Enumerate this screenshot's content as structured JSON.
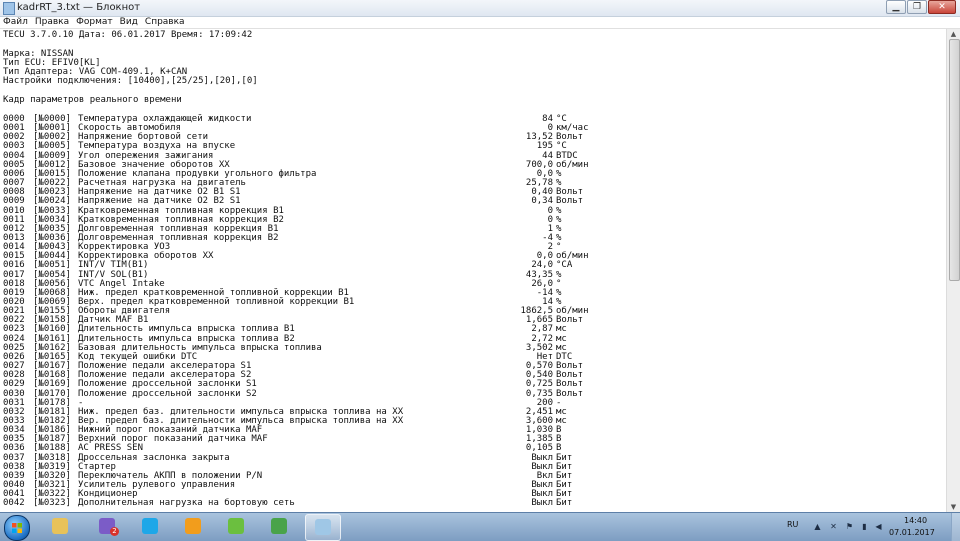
{
  "window": {
    "title": "kadrRT_3.txt — Блокнот"
  },
  "menu": [
    "Файл",
    "Правка",
    "Формат",
    "Вид",
    "Справка"
  ],
  "header": {
    "line1": "TECU 3.7.0.10 Дата: 06.01.2017 Время: 17:09:42",
    "make": "Марка: NISSAN",
    "ecu": "Тип ECU: EFIV0[KL]",
    "adapter": "Тип Адаптера: VAG COM-409.1, K+CAN",
    "settings": "Настройки подключения: [10400],[25/25],[20],[0]",
    "frame": "Кадр параметров реального времени"
  },
  "rows": [
    {
      "idx": "0000",
      "code": "[№0000]",
      "name": "Температура охлаждающей жидкости",
      "value": "84",
      "unit": "°C"
    },
    {
      "idx": "0001",
      "code": "[№0001]",
      "name": "Скорость автомобиля",
      "value": "0",
      "unit": "км/час"
    },
    {
      "idx": "0002",
      "code": "[№0002]",
      "name": "Напряжение бортовой сети",
      "value": "13,52",
      "unit": "Вольт"
    },
    {
      "idx": "0003",
      "code": "[№0005]",
      "name": "Температура воздуха на впуске",
      "value": "195",
      "unit": "°C"
    },
    {
      "idx": "0004",
      "code": "[№0009]",
      "name": "Угол опережения зажигания",
      "value": "44",
      "unit": "BTDC"
    },
    {
      "idx": "0005",
      "code": "[№0012]",
      "name": "Базовое значение оборотов XX",
      "value": "700,0",
      "unit": "об/мин"
    },
    {
      "idx": "0006",
      "code": "[№0015]",
      "name": "Положение клапана продувки угольного фильтра",
      "value": "0,0",
      "unit": "%"
    },
    {
      "idx": "0007",
      "code": "[№0022]",
      "name": "Расчетная нагрузка на двигатель",
      "value": "25,78",
      "unit": "%"
    },
    {
      "idx": "0008",
      "code": "[№0023]",
      "name": "Напряжение на датчике O2 B1 S1",
      "value": "0,40",
      "unit": "Вольт"
    },
    {
      "idx": "0009",
      "code": "[№0024]",
      "name": "Напряжение на датчике O2 B2 S1",
      "value": "0,34",
      "unit": "Вольт"
    },
    {
      "idx": "0010",
      "code": "[№0033]",
      "name": "Кратковременная топливная коррекция B1",
      "value": "0",
      "unit": "%"
    },
    {
      "idx": "0011",
      "code": "[№0034]",
      "name": "Кратковременная топливная коррекция B2",
      "value": "0",
      "unit": "%"
    },
    {
      "idx": "0012",
      "code": "[№0035]",
      "name": "Долговременная топливная коррекция B1",
      "value": "1",
      "unit": "%"
    },
    {
      "idx": "0013",
      "code": "[№0036]",
      "name": "Долговременная топливная коррекция B2",
      "value": "-4",
      "unit": "%"
    },
    {
      "idx": "0014",
      "code": "[№0043]",
      "name": "Корректировка УОЗ",
      "value": "2",
      "unit": "°"
    },
    {
      "idx": "0015",
      "code": "[№0044]",
      "name": "Корректировка оборотов XX",
      "value": "0,0",
      "unit": "об/мин"
    },
    {
      "idx": "0016",
      "code": "[№0051]",
      "name": "INT/V TIM(B1)",
      "value": "24,0",
      "unit": "°CA"
    },
    {
      "idx": "0017",
      "code": "[№0054]",
      "name": "INT/V SOL(B1)",
      "value": "43,35",
      "unit": "%"
    },
    {
      "idx": "0018",
      "code": "[№0056]",
      "name": "VTC Angel Intake",
      "value": "26,0",
      "unit": "°"
    },
    {
      "idx": "0019",
      "code": "[№0068]",
      "name": "Ниж. предел кратковременной топливной коррекции B1",
      "value": "-14",
      "unit": "%"
    },
    {
      "idx": "0020",
      "code": "[№0069]",
      "name": "Верх. предел кратковременной топливной коррекции B1",
      "value": "14",
      "unit": "%"
    },
    {
      "idx": "0021",
      "code": "[№0155]",
      "name": "Обороты двигателя",
      "value": "1862,5",
      "unit": "об/мин"
    },
    {
      "idx": "0022",
      "code": "[№0158]",
      "name": "Датчик MAF B1",
      "value": "1,665",
      "unit": "Вольт"
    },
    {
      "idx": "0023",
      "code": "[№0160]",
      "name": "Длительность импульса впрыска топлива B1",
      "value": "2,87",
      "unit": "мс"
    },
    {
      "idx": "0024",
      "code": "[№0161]",
      "name": "Длительность импульса впрыска топлива B2",
      "value": "2,72",
      "unit": "мс"
    },
    {
      "idx": "0025",
      "code": "[№0162]",
      "name": "Базовая длительность импульса впрыска топлива",
      "value": "3,502",
      "unit": "мс"
    },
    {
      "idx": "0026",
      "code": "[№0165]",
      "name": "Код текущей ошибки DTC",
      "value": "Нет",
      "unit": "DTC"
    },
    {
      "idx": "0027",
      "code": "[№0167]",
      "name": "Положение педали акселератора S1",
      "value": "0,570",
      "unit": "Вольт"
    },
    {
      "idx": "0028",
      "code": "[№0168]",
      "name": "Положение педали акселератора S2",
      "value": "0,540",
      "unit": "Вольт"
    },
    {
      "idx": "0029",
      "code": "[№0169]",
      "name": "Положение дроссельной заслонки S1",
      "value": "0,725",
      "unit": "Вольт"
    },
    {
      "idx": "0030",
      "code": "[№0170]",
      "name": "Положение дроссельной заслонки S2",
      "value": "0,735",
      "unit": "Вольт"
    },
    {
      "idx": "0031",
      "code": "[№0178]",
      "name": "-",
      "value": "200",
      "unit": "-"
    },
    {
      "idx": "0032",
      "code": "[№0181]",
      "name": "Ниж. предел баз. длительности импульса впрыска топлива на XX",
      "value": "2,451",
      "unit": "мс"
    },
    {
      "idx": "0033",
      "code": "[№0182]",
      "name": "Вер. предел баз. длительности импульса впрыска топлива на XX",
      "value": "3,600",
      "unit": "мс"
    },
    {
      "idx": "0034",
      "code": "[№0186]",
      "name": "Нижний порог показаний датчика MAF",
      "value": "1,030",
      "unit": "В"
    },
    {
      "idx": "0035",
      "code": "[№0187]",
      "name": "Верхний порог показаний датчика MAF",
      "value": "1,385",
      "unit": "В"
    },
    {
      "idx": "0036",
      "code": "[№0188]",
      "name": "AC PRESS SEN",
      "value": "0,105",
      "unit": "В"
    },
    {
      "idx": "0037",
      "code": "[№0318]",
      "name": "Дроссельная заслонка закрыта",
      "value": "Выкл",
      "unit": "Бит"
    },
    {
      "idx": "0038",
      "code": "[№0319]",
      "name": "Стартер",
      "value": "Выкл",
      "unit": "Бит"
    },
    {
      "idx": "0039",
      "code": "[№0320]",
      "name": "Переключатель АКПП в положении P/N",
      "value": "Вкл",
      "unit": "Бит"
    },
    {
      "idx": "0040",
      "code": "[№0321]",
      "name": "Усилитель рулевого управления",
      "value": "Выкл",
      "unit": "Бит"
    },
    {
      "idx": "0041",
      "code": "[№0322]",
      "name": "Кондиционер",
      "value": "Выкл",
      "unit": "Бит"
    },
    {
      "idx": "0042",
      "code": "[№0323]",
      "name": "Дополнительная нагрузка на бортовую сеть",
      "value": "Выкл",
      "unit": "Бит"
    }
  ],
  "taskbar": {
    "apps": [
      {
        "name": "explorer-icon",
        "color": "#e8c25a"
      },
      {
        "name": "viber-icon",
        "color": "#7b5cc7"
      },
      {
        "name": "skype-icon",
        "color": "#1ea7e8"
      },
      {
        "name": "avast-icon",
        "color": "#f29d1c"
      },
      {
        "name": "sleipnir-icon",
        "color": "#6bbf3f"
      },
      {
        "name": "activity-icon",
        "color": "#49a34a"
      },
      {
        "name": "notepad-icon",
        "color": "#9fc7e6"
      }
    ],
    "viber_badge": "2",
    "lang": "RU",
    "time": "14:40",
    "date": "07.01.2017"
  }
}
